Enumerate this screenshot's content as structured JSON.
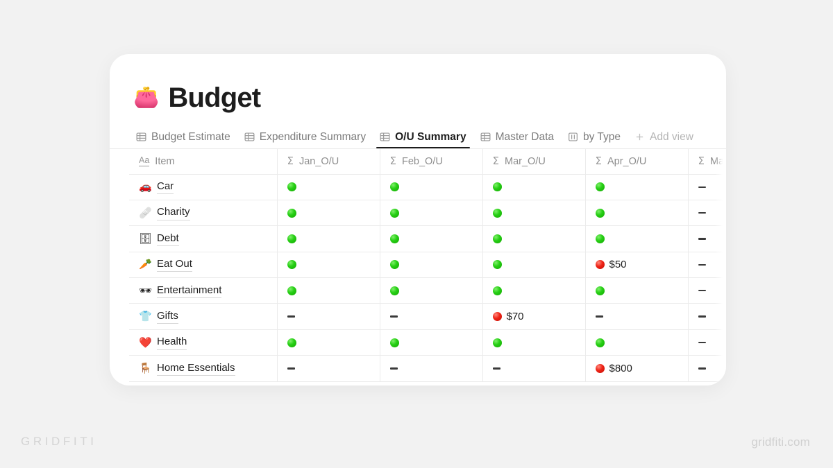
{
  "page": {
    "title": "Budget",
    "title_emoji": "👛"
  },
  "tabs": [
    {
      "label": "Budget Estimate",
      "icon": "table-icon",
      "active": false
    },
    {
      "label": "Expenditure Summary",
      "icon": "table-icon",
      "active": false
    },
    {
      "label": "O/U Summary",
      "icon": "table-icon",
      "active": true
    },
    {
      "label": "Master Data",
      "icon": "table-icon",
      "active": false
    },
    {
      "label": "by Type",
      "icon": "board-icon",
      "active": false
    },
    {
      "label": "Add view",
      "icon": "plus-icon",
      "active": false
    }
  ],
  "table": {
    "columns": [
      {
        "label": "Item",
        "icon": "text-aa-icon"
      },
      {
        "label": "Jan_O/U",
        "icon": "sigma-icon"
      },
      {
        "label": "Feb_O/U",
        "icon": "sigma-icon"
      },
      {
        "label": "Mar_O/U",
        "icon": "sigma-icon"
      },
      {
        "label": "Apr_O/U",
        "icon": "sigma-icon"
      },
      {
        "label": "May_O/U",
        "icon": "sigma-icon"
      },
      {
        "label": "",
        "icon": "sigma-icon"
      }
    ],
    "rows": [
      {
        "emoji": "🚗",
        "item": "Car",
        "cells": [
          {
            "status": "green",
            "value": ""
          },
          {
            "status": "green",
            "value": ""
          },
          {
            "status": "green",
            "value": ""
          },
          {
            "status": "green",
            "value": ""
          },
          {
            "status": "none",
            "value": ""
          },
          {
            "status": "none",
            "value": ""
          }
        ]
      },
      {
        "emoji": "🩹",
        "item": "Charity",
        "cells": [
          {
            "status": "green",
            "value": ""
          },
          {
            "status": "green",
            "value": ""
          },
          {
            "status": "green",
            "value": ""
          },
          {
            "status": "green",
            "value": ""
          },
          {
            "status": "none",
            "value": ""
          },
          {
            "status": "none",
            "value": ""
          }
        ]
      },
      {
        "emoji": "🗄",
        "item": "Debt",
        "cells": [
          {
            "status": "green",
            "value": ""
          },
          {
            "status": "green",
            "value": ""
          },
          {
            "status": "green",
            "value": ""
          },
          {
            "status": "green",
            "value": ""
          },
          {
            "status": "none",
            "value": ""
          },
          {
            "status": "none",
            "value": ""
          }
        ]
      },
      {
        "emoji": "🥕",
        "item": "Eat Out",
        "cells": [
          {
            "status": "green",
            "value": ""
          },
          {
            "status": "green",
            "value": ""
          },
          {
            "status": "green",
            "value": ""
          },
          {
            "status": "red",
            "value": "$50"
          },
          {
            "status": "none",
            "value": ""
          },
          {
            "status": "none",
            "value": ""
          }
        ]
      },
      {
        "emoji": "🕶",
        "item": "Entertainment",
        "cells": [
          {
            "status": "green",
            "value": ""
          },
          {
            "status": "green",
            "value": ""
          },
          {
            "status": "green",
            "value": ""
          },
          {
            "status": "green",
            "value": ""
          },
          {
            "status": "none",
            "value": ""
          },
          {
            "status": "none",
            "value": ""
          }
        ]
      },
      {
        "emoji": "👕",
        "item": "Gifts",
        "cells": [
          {
            "status": "none",
            "value": ""
          },
          {
            "status": "none",
            "value": ""
          },
          {
            "status": "red",
            "value": "$70"
          },
          {
            "status": "none",
            "value": ""
          },
          {
            "status": "none",
            "value": ""
          },
          {
            "status": "none",
            "value": ""
          }
        ]
      },
      {
        "emoji": "❤️",
        "item": "Health",
        "cells": [
          {
            "status": "green",
            "value": ""
          },
          {
            "status": "green",
            "value": ""
          },
          {
            "status": "green",
            "value": ""
          },
          {
            "status": "green",
            "value": ""
          },
          {
            "status": "none",
            "value": ""
          },
          {
            "status": "none",
            "value": ""
          }
        ]
      },
      {
        "emoji": "🪑",
        "item": "Home Essentials",
        "cells": [
          {
            "status": "none",
            "value": ""
          },
          {
            "status": "none",
            "value": ""
          },
          {
            "status": "none",
            "value": ""
          },
          {
            "status": "red",
            "value": "$800"
          },
          {
            "status": "none",
            "value": ""
          },
          {
            "status": "none",
            "value": ""
          }
        ]
      }
    ]
  },
  "watermark": {
    "left": "GRIDFITI",
    "right": "gridfiti.com"
  },
  "colors": {
    "background": "#f2f2f2",
    "card": "#ffffff",
    "text": "#1d1d1d",
    "muted": "#8d8d8d",
    "border": "#ebebeb",
    "green": "#27cf15",
    "red": "#ee2316"
  }
}
